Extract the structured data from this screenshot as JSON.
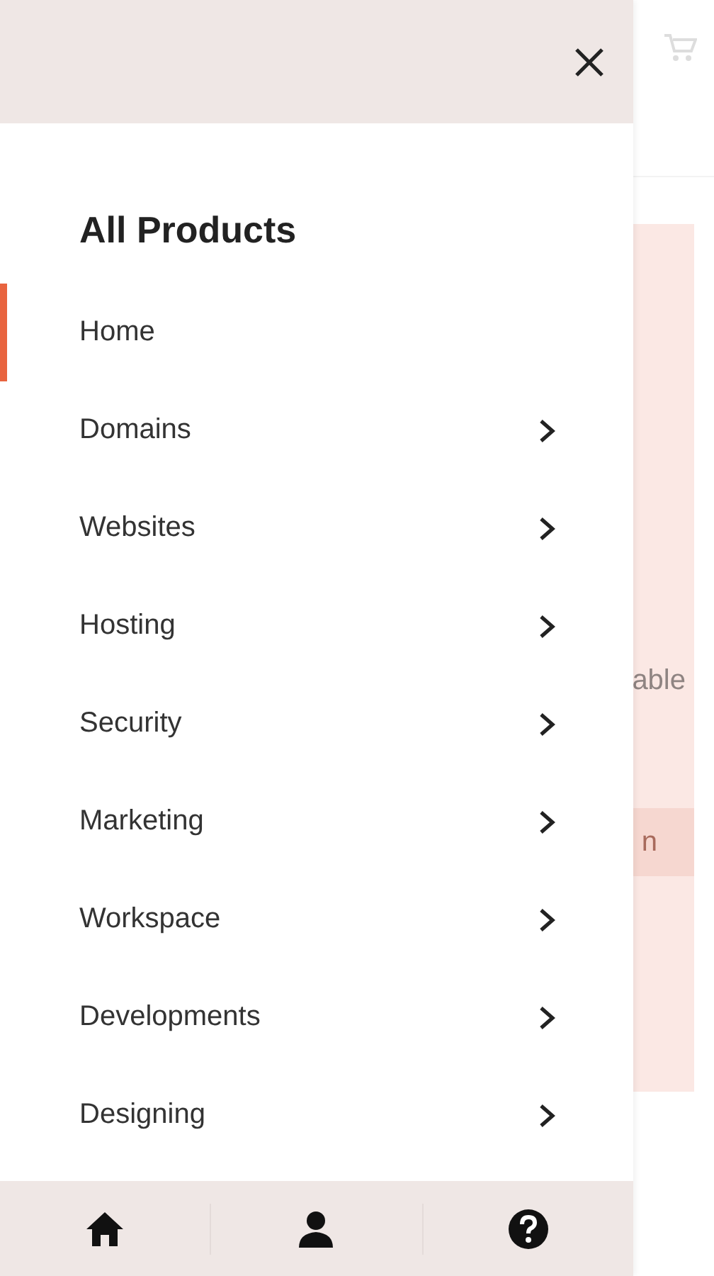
{
  "background_page": {
    "hero_text": "able",
    "hero_button": "n"
  },
  "drawer": {
    "title": "All Products",
    "items": [
      {
        "label": "Home",
        "selected": true,
        "has_submenu": false
      },
      {
        "label": "Domains",
        "selected": false,
        "has_submenu": true
      },
      {
        "label": "Websites",
        "selected": false,
        "has_submenu": true
      },
      {
        "label": "Hosting",
        "selected": false,
        "has_submenu": true
      },
      {
        "label": "Security",
        "selected": false,
        "has_submenu": true
      },
      {
        "label": "Marketing",
        "selected": false,
        "has_submenu": true
      },
      {
        "label": "Workspace",
        "selected": false,
        "has_submenu": true
      },
      {
        "label": "Developments",
        "selected": false,
        "has_submenu": true
      },
      {
        "label": "Designing",
        "selected": false,
        "has_submenu": true
      }
    ],
    "bottom_nav": [
      {
        "kind": "home"
      },
      {
        "kind": "account"
      },
      {
        "kind": "help"
      }
    ]
  }
}
